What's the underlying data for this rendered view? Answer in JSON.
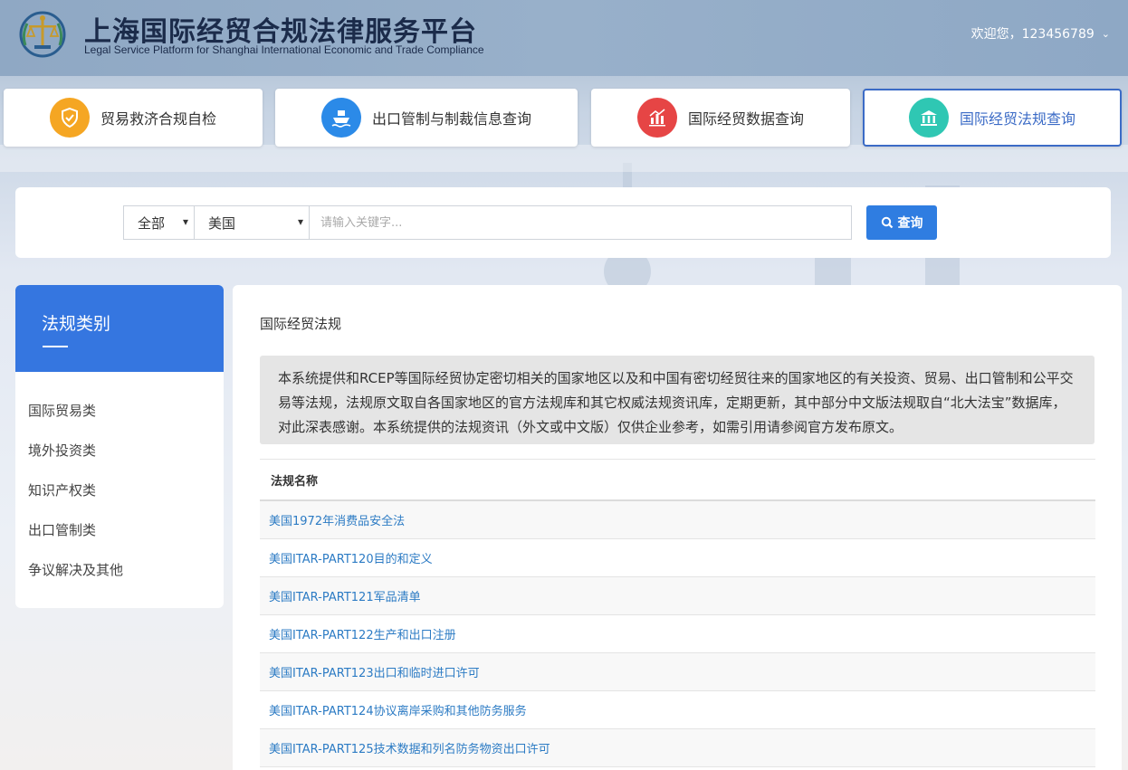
{
  "header": {
    "title": "上海国际经贸合规法律服务平台",
    "subtitle": "Legal Service Platform for Shanghai International Economic and Trade Compliance",
    "user_greeting": "欢迎您，123456789",
    "user_chevron": "⌄"
  },
  "nav": [
    {
      "label": "贸易救济合规自检",
      "icon": "shield-check-icon",
      "color": "#f5a623"
    },
    {
      "label": "出口管制与制裁信息查询",
      "icon": "ship-icon",
      "color": "#2b8ae8"
    },
    {
      "label": "国际经贸数据查询",
      "icon": "bar-chart-icon",
      "color": "#e64545"
    },
    {
      "label": "国际经贸法规查询",
      "icon": "bank-icon",
      "color": "#2fc7b3"
    }
  ],
  "search": {
    "scope_value": "全部",
    "country_value": "美国",
    "placeholder": "请输入关键字...",
    "button_label": "查询"
  },
  "sidebar": {
    "title": "法规类别",
    "items": [
      {
        "label": "国际贸易类"
      },
      {
        "label": "境外投资类"
      },
      {
        "label": "知识产权类"
      },
      {
        "label": "出口管制类"
      },
      {
        "label": "争议解决及其他"
      }
    ]
  },
  "main": {
    "title": "国际经贸法规",
    "notice": "本系统提供和RCEP等国际经贸协定密切相关的国家地区以及和中国有密切经贸往来的国家地区的有关投资、贸易、出口管制和公平交易等法规，法规原文取自各国家地区的官方法规库和其它权威法规资讯库，定期更新，其中部分中文版法规取自“北大法宝”数据库，对此深表感谢。本系统提供的法规资讯（外文或中文版）仅供企业参考，如需引用请参阅官方发布原文。",
    "table_header": "法规名称",
    "rows": [
      {
        "name": "美国1972年消费品安全法"
      },
      {
        "name": "美国ITAR-PART120目的和定义"
      },
      {
        "name": "美国ITAR-PART121军品清单"
      },
      {
        "name": "美国ITAR-PART122生产和出口注册"
      },
      {
        "name": "美国ITAR-PART123出口和临时进口许可"
      },
      {
        "name": "美国ITAR-PART124协议离岸采购和其他防务服务"
      },
      {
        "name": "美国ITAR-PART125技术数据和列名防务物资出口许可"
      }
    ]
  },
  "colors": {
    "primary": "#3576e0",
    "link": "#2c7bc4",
    "search_button": "#2f7de1"
  }
}
